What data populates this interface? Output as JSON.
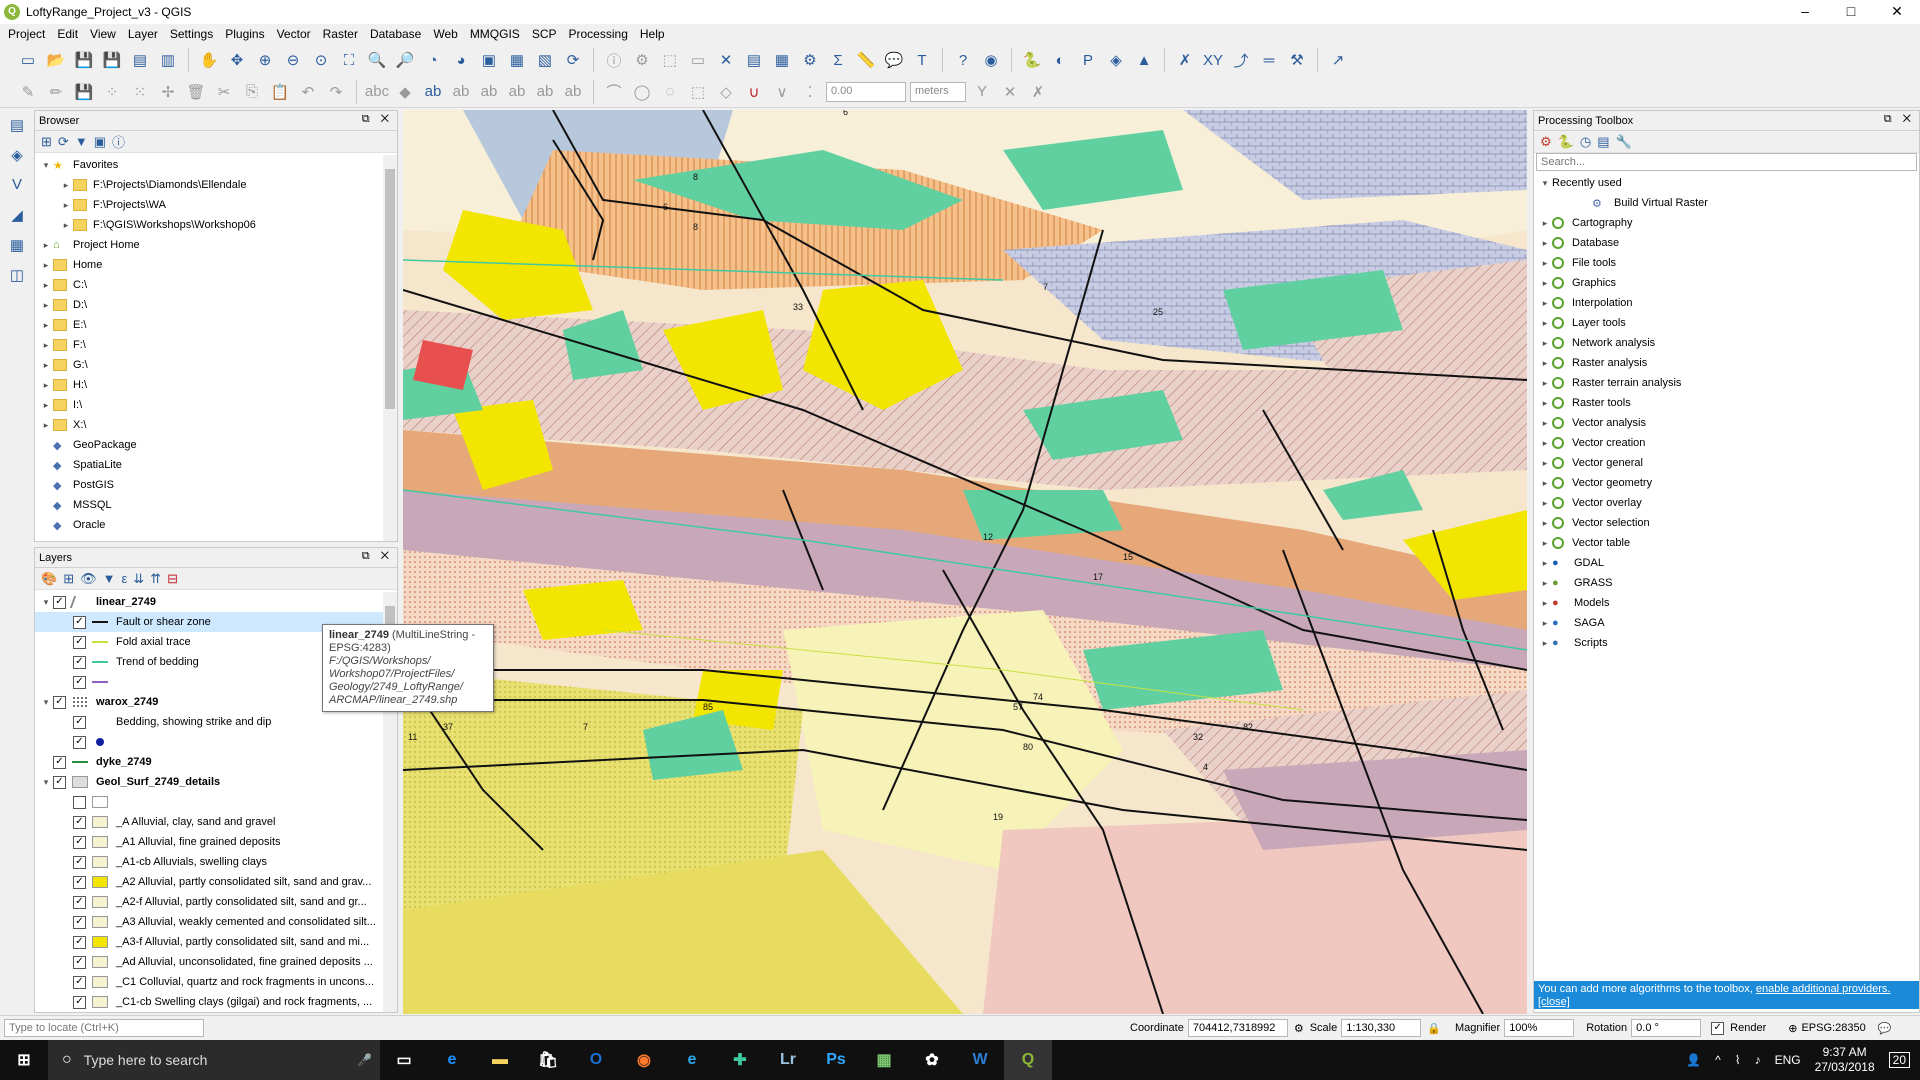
{
  "window": {
    "title": "LoftyRange_Project_v3 - QGIS",
    "logo": "Q",
    "min": "–",
    "max": "□",
    "close": "✕"
  },
  "menu": [
    "Project",
    "Edit",
    "View",
    "Layer",
    "Settings",
    "Plugins",
    "Vector",
    "Raster",
    "Database",
    "Web",
    "MMQGIS",
    "SCP",
    "Processing",
    "Help"
  ],
  "toolbar2": {
    "value": "0.00",
    "units": "meters"
  },
  "browser": {
    "title": "Browser",
    "items": [
      {
        "label": "Favorites",
        "kind": "star",
        "indent": 0,
        "exp": "open"
      },
      {
        "label": "F:\\Projects\\Diamonds\\Ellendale",
        "kind": "folder",
        "indent": 1,
        "exp": "closed"
      },
      {
        "label": "F:\\Projects\\WA",
        "kind": "folder",
        "indent": 1,
        "exp": "closed"
      },
      {
        "label": "F:\\QGIS\\Workshops\\Workshop06",
        "kind": "folder",
        "indent": 1,
        "exp": "closed"
      },
      {
        "label": "Project Home",
        "kind": "home",
        "indent": 0,
        "exp": "closed"
      },
      {
        "label": "Home",
        "kind": "folder",
        "indent": 0,
        "exp": "closed"
      },
      {
        "label": "C:\\",
        "kind": "folder",
        "indent": 0,
        "exp": "closed"
      },
      {
        "label": "D:\\",
        "kind": "folder",
        "indent": 0,
        "exp": "closed"
      },
      {
        "label": "E:\\",
        "kind": "folder",
        "indent": 0,
        "exp": "closed"
      },
      {
        "label": "F:\\",
        "kind": "folder",
        "indent": 0,
        "exp": "closed"
      },
      {
        "label": "G:\\",
        "kind": "folder",
        "indent": 0,
        "exp": "closed"
      },
      {
        "label": "H:\\",
        "kind": "folder",
        "indent": 0,
        "exp": "closed"
      },
      {
        "label": "I:\\",
        "kind": "folder",
        "indent": 0,
        "exp": "closed"
      },
      {
        "label": "X:\\",
        "kind": "folder",
        "indent": 0,
        "exp": "closed"
      },
      {
        "label": "GeoPackage",
        "kind": "db",
        "indent": 0,
        "exp": "none"
      },
      {
        "label": "SpatiaLite",
        "kind": "db",
        "indent": 0,
        "exp": "none"
      },
      {
        "label": "PostGIS",
        "kind": "db",
        "indent": 0,
        "exp": "none"
      },
      {
        "label": "MSSQL",
        "kind": "db",
        "indent": 0,
        "exp": "none"
      },
      {
        "label": "Oracle",
        "kind": "db",
        "indent": 0,
        "exp": "none"
      }
    ]
  },
  "layers": {
    "title": "Layers",
    "items": [
      {
        "label": "linear_2749",
        "bold": true,
        "indent": 0,
        "exp": "open",
        "checked": true,
        "sym": "line-gray"
      },
      {
        "label": "Fault or shear zone",
        "indent": 1,
        "checked": true,
        "sym": "line-black",
        "selected": true
      },
      {
        "label": "Fold axial trace",
        "indent": 1,
        "checked": true,
        "sym": "line-lime"
      },
      {
        "label": "Trend of bedding",
        "indent": 1,
        "checked": true,
        "sym": "line-teal"
      },
      {
        "label": "",
        "indent": 1,
        "checked": true,
        "sym": "line-purple"
      },
      {
        "label": "warox_2749",
        "bold": true,
        "indent": 0,
        "exp": "open",
        "checked": true,
        "sym": "dots"
      },
      {
        "label": "Bedding, showing strike and dip",
        "indent": 1,
        "checked": true,
        "sym": "none"
      },
      {
        "label": "",
        "indent": 1,
        "checked": true,
        "sym": "dot-blue"
      },
      {
        "label": "dyke_2749",
        "bold": true,
        "indent": 0,
        "exp": "none",
        "checked": true,
        "sym": "line-green"
      },
      {
        "label": "Geol_Surf_2749_details",
        "bold": true,
        "indent": 0,
        "exp": "open",
        "checked": true,
        "sym": "poly-gray"
      },
      {
        "label": "",
        "indent": 1,
        "checked": false,
        "sym": "box-white"
      },
      {
        "label": "_A Alluvial, clay, sand and gravel",
        "indent": 1,
        "checked": true,
        "sym": "box-cream"
      },
      {
        "label": "_A1 Alluvial, fine grained deposits",
        "indent": 1,
        "checked": true,
        "sym": "box-cream"
      },
      {
        "label": "_A1-cb Alluvials, swelling clays",
        "indent": 1,
        "checked": true,
        "sym": "box-cream"
      },
      {
        "label": "_A2 Alluvial, partly consolidated silt, sand and grav...",
        "indent": 1,
        "checked": true,
        "sym": "box-yellow"
      },
      {
        "label": "_A2-f Alluvial, partly consolidated silt, sand and gr...",
        "indent": 1,
        "checked": true,
        "sym": "box-cream"
      },
      {
        "label": "_A3 Alluvial, weakly cemented and consolidated silt...",
        "indent": 1,
        "checked": true,
        "sym": "box-cream"
      },
      {
        "label": "_A3-f Alluvial, partly consolidated silt, sand and mi...",
        "indent": 1,
        "checked": true,
        "sym": "box-yellow"
      },
      {
        "label": "_Ad Alluvial, unconsolidated, fine grained deposits ...",
        "indent": 1,
        "checked": true,
        "sym": "box-cream"
      },
      {
        "label": "_C1 Colluvial, quartz and rock fragments in uncons...",
        "indent": 1,
        "checked": true,
        "sym": "box-cream"
      },
      {
        "label": "_C1-cb Swelling clays (gilgai) and rock fragments, ...",
        "indent": 1,
        "checked": true,
        "sym": "box-cream"
      }
    ]
  },
  "tooltip": {
    "name": "linear_2749",
    "type": " (MultiLineString -",
    "crs": "EPSG:4283)",
    "path": [
      "F:/QGIS/Workshops/",
      "Workshop07/ProjectFiles/",
      "Geology/2749_LoftyRange/",
      "ARCMAP/linear_2749.shp"
    ]
  },
  "toolbox": {
    "title": "Processing Toolbox",
    "search_placeholder": "Search...",
    "recent": "Recently used",
    "recent_item": "Build Virtual Raster",
    "groups": [
      "Cartography",
      "Database",
      "File tools",
      "Graphics",
      "Interpolation",
      "Layer tools",
      "Network analysis",
      "Raster analysis",
      "Raster terrain analysis",
      "Raster tools",
      "Vector analysis",
      "Vector creation",
      "Vector general",
      "Vector geometry",
      "Vector overlay",
      "Vector selection",
      "Vector table"
    ],
    "providers": [
      {
        "label": "GDAL",
        "icon": "gdal-icon",
        "color": "#1a5fb4"
      },
      {
        "label": "GRASS",
        "icon": "grass-icon",
        "color": "#6a9b2e"
      },
      {
        "label": "Models",
        "icon": "models-icon",
        "color": "#c0392b"
      },
      {
        "label": "SAGA",
        "icon": "saga-icon",
        "color": "#2a6fbb"
      },
      {
        "label": "Scripts",
        "icon": "python-icon",
        "color": "#3a75b0"
      }
    ],
    "banner_text": "You can add more algorithms to the toolbox, ",
    "banner_link": "enable additional providers.",
    "banner_close": "[close]"
  },
  "map": {
    "labels": [
      "8",
      "6",
      "8",
      "6",
      "7",
      "33",
      "25",
      "12",
      "17",
      "15",
      "29",
      "75",
      "45",
      "37",
      "11",
      "85",
      "7",
      "57",
      "74",
      "82",
      "32",
      "4",
      "80",
      "19"
    ]
  },
  "status": {
    "locate_placeholder": "Type to locate (Ctrl+K)",
    "coord_label": "Coordinate",
    "coord": "704412,7318992",
    "scale_label": "Scale",
    "scale": "1:130,330",
    "magnifier_label": "Magnifier",
    "magnifier": "100%",
    "rotation_label": "Rotation",
    "rotation": "0.0 °",
    "render": "Render",
    "crs": "EPSG:28350"
  },
  "taskbar": {
    "search": "Type here to search",
    "time": "9:37 AM",
    "date": "27/03/2018",
    "lang": "ENG",
    "notif": "20"
  }
}
